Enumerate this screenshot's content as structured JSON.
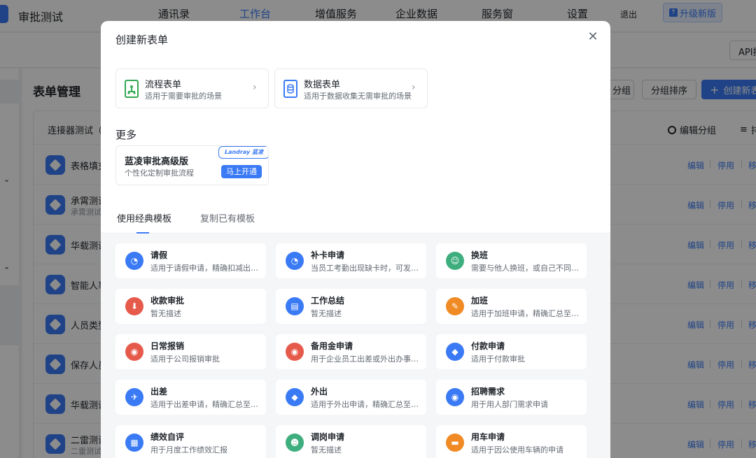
{
  "app": {
    "name": "审批测试",
    "nav": [
      "通讯录",
      "工作台",
      "增值服务",
      "企业数据",
      "服务窗",
      "设置"
    ],
    "nav_active": "工作台",
    "logout": "退出",
    "upgrade": "升级新版",
    "api_button": "API接"
  },
  "page": {
    "title": "表单管理",
    "buttons": {
      "group": "分组",
      "group_sort": "分组排序",
      "create": "创建新表"
    },
    "group_title": "连接器测试（",
    "group_actions": {
      "edit_group": "编辑分组",
      "sort": "排"
    },
    "rows": [
      {
        "name": "表格填充",
        "sub": ""
      },
      {
        "name": "承霄测试",
        "sub": "承霄测试"
      },
      {
        "name": "华载测试",
        "sub": ""
      },
      {
        "name": "智能人事",
        "sub": ""
      },
      {
        "name": "人员类型",
        "sub": ""
      },
      {
        "name": "保存人员",
        "sub": ""
      },
      {
        "name": "华载测试",
        "sub": ""
      },
      {
        "name": "二雷测试",
        "sub": "二雷测试"
      }
    ],
    "row_ops": {
      "edit": "编辑",
      "disable": "停用",
      "move": "移"
    }
  },
  "modal": {
    "title": "创建新表单",
    "close_icon": "close-icon",
    "form_types": [
      {
        "title": "流程表单",
        "desc": "适用于需要审批的场景",
        "icon": "flow-form-icon",
        "color": "#34a853"
      },
      {
        "title": "数据表单",
        "desc": "适用于数据收集无需审批的场景",
        "icon": "data-form-icon",
        "color": "#3a7af5"
      }
    ],
    "more_title": "更多",
    "promo": {
      "title": "蓝凌审批高级版",
      "desc": "个性化定制审批流程",
      "logo": "Landray 蓝凌",
      "button": "马上开通"
    },
    "tabs": [
      "使用经典模板",
      "复制已有模板"
    ],
    "active_tab": "使用经典模板",
    "templates": [
      {
        "name": "请假",
        "desc": "适用于请假申请，精确扣减出勤天数",
        "icon": "clock-icon",
        "color": "#3a7af5"
      },
      {
        "name": "补卡申请",
        "desc": "当员工考勤出现缺卡时，可发起补卡申请",
        "icon": "clock-icon",
        "color": "#3a7af5"
      },
      {
        "name": "换班",
        "desc": "需要与他人换班，或自己不同班次调换",
        "icon": "swap-user-icon",
        "color": "#3fae7e"
      },
      {
        "name": "收款审批",
        "desc": "暂无描述",
        "icon": "download-icon",
        "color": "#e65a4b"
      },
      {
        "name": "工作总结",
        "desc": "暂无描述",
        "icon": "document-icon",
        "color": "#3a7af5"
      },
      {
        "name": "加班",
        "desc": "适用于加班申请，精确汇总至考勤",
        "icon": "overtime-icon",
        "color": "#f08a24"
      },
      {
        "name": "日常报销",
        "desc": "适用于公司报销审批",
        "icon": "money-bag-icon",
        "color": "#e65a4b"
      },
      {
        "name": "备用金申请",
        "desc": "用于企业员工出差或外出办事预借款",
        "icon": "money-bag-icon",
        "color": "#e65a4b"
      },
      {
        "name": "付款申请",
        "desc": "适用于付款审批",
        "icon": "diamond-icon",
        "color": "#3a7af5"
      },
      {
        "name": "出差",
        "desc": "适用于出差申请，精确汇总至考勤",
        "icon": "plane-icon",
        "color": "#3a7af5"
      },
      {
        "name": "外出",
        "desc": "适用于外出申请，精确汇总至考勤",
        "icon": "diamond-icon",
        "color": "#3a7af5"
      },
      {
        "name": "招聘需求",
        "desc": "用于用人部门需求申请",
        "icon": "eye-icon",
        "color": "#3a7af5"
      },
      {
        "name": "绩效自评",
        "desc": "用于月度工作绩效汇报",
        "icon": "chart-icon",
        "color": "#3a7af5"
      },
      {
        "name": "调岗申请",
        "desc": "暂无描述",
        "icon": "user-icon",
        "color": "#3fae7e"
      },
      {
        "name": "用车申请",
        "desc": "适用于因公使用车辆的申请",
        "icon": "car-icon",
        "color": "#f08a24"
      }
    ]
  },
  "colors": {
    "accent": "#3a7af5",
    "green": "#3fae7e",
    "red": "#e65a4b",
    "orange": "#f08a24"
  }
}
